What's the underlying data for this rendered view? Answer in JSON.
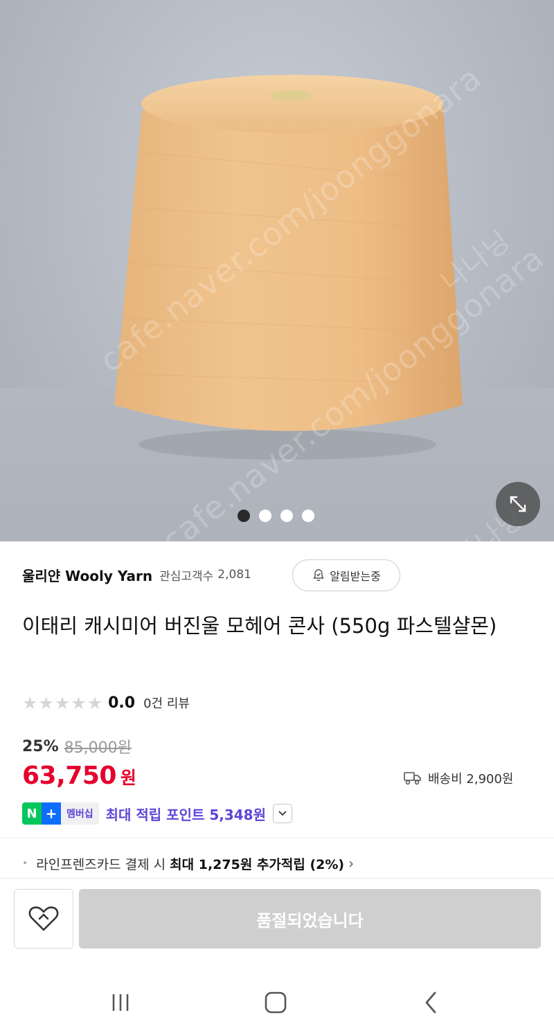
{
  "gallery": {
    "watermarks": [
      "cafe.naver.com/joonggonara",
      "cafe.naver.com/joonggonara",
      "나나닝",
      "나나닝"
    ],
    "page_count": 4,
    "active_page": 1,
    "expand_icon": "expand-icon"
  },
  "seller": {
    "name": "울리얀 Wooly Yarn",
    "follower_label": "관심고객수",
    "follower_count": "2,081",
    "alarm_label": "알림받는중",
    "alarm_icon": "bell-check-icon"
  },
  "product": {
    "title": "이태리 캐시미어 버진울 모헤어 콘사 (550g 파스텔샬몬)"
  },
  "rating": {
    "stars_filled": 0,
    "stars_total": 5,
    "score": "0.0",
    "review_text": "0건 리뷰"
  },
  "price": {
    "discount_rate": "25%",
    "original": "85,000원",
    "sale": "63,750",
    "currency": "원",
    "accent_color": "#e5002d"
  },
  "shipping": {
    "icon": "truck-icon",
    "text": "배송비 2,900원"
  },
  "membership": {
    "badge_n": "N",
    "badge_plus": "+",
    "badge_label": "멤버십",
    "text": "최대 적립 포인트 5,348원",
    "accent_color": "#5b45d8"
  },
  "card_benefit": {
    "prefix": "라인프렌즈카드 결제 시",
    "highlight": "최대 1,275원 추가적립 (2%)"
  },
  "actions": {
    "wishlist_icon": "heart-icon",
    "soldout_label": "품절되었습니다"
  },
  "navbar": {
    "recent_icon": "recent-apps-icon",
    "home_icon": "home-icon",
    "back_icon": "back-icon"
  }
}
